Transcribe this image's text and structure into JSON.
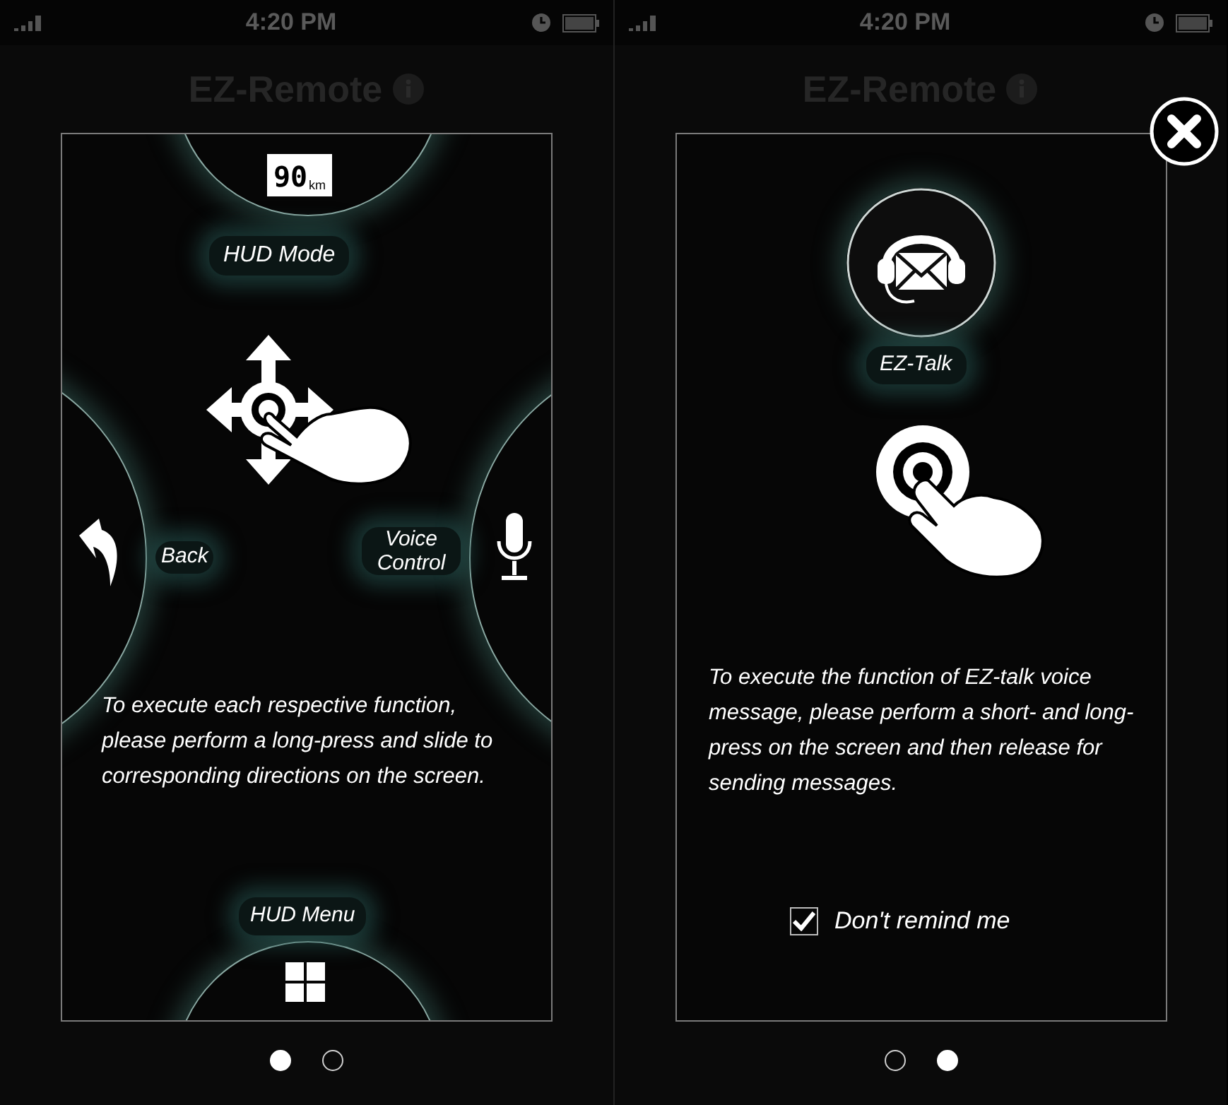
{
  "screens": [
    {
      "kind": "gestures",
      "status_bar": {
        "time": "4:20 PM"
      },
      "app_title": "EZ-Remote",
      "speed_badge": {
        "value": "90",
        "unit": "km"
      },
      "top_label": "HUD Mode",
      "left_label": "Back",
      "right_label": "Voice Control",
      "bottom_label": "HUD Menu",
      "instruction": "To execute each respective function, please perform a long-press and slide to corresponding directions on the screen.",
      "pager": [
        {
          "selected": true
        },
        {
          "selected": false
        }
      ]
    },
    {
      "kind": "ez_talk",
      "status_bar": {
        "time": "4:20 PM"
      },
      "app_title": "EZ-Remote",
      "feature_label": "EZ-Talk",
      "instruction": "To execute the function of EZ-talk voice message, please perform a short- and long-press on the screen and then release for sending messages.",
      "reminder": {
        "label": "Don't remind me",
        "checked": true
      },
      "pager": [
        {
          "selected": false
        },
        {
          "selected": true
        }
      ]
    }
  ]
}
